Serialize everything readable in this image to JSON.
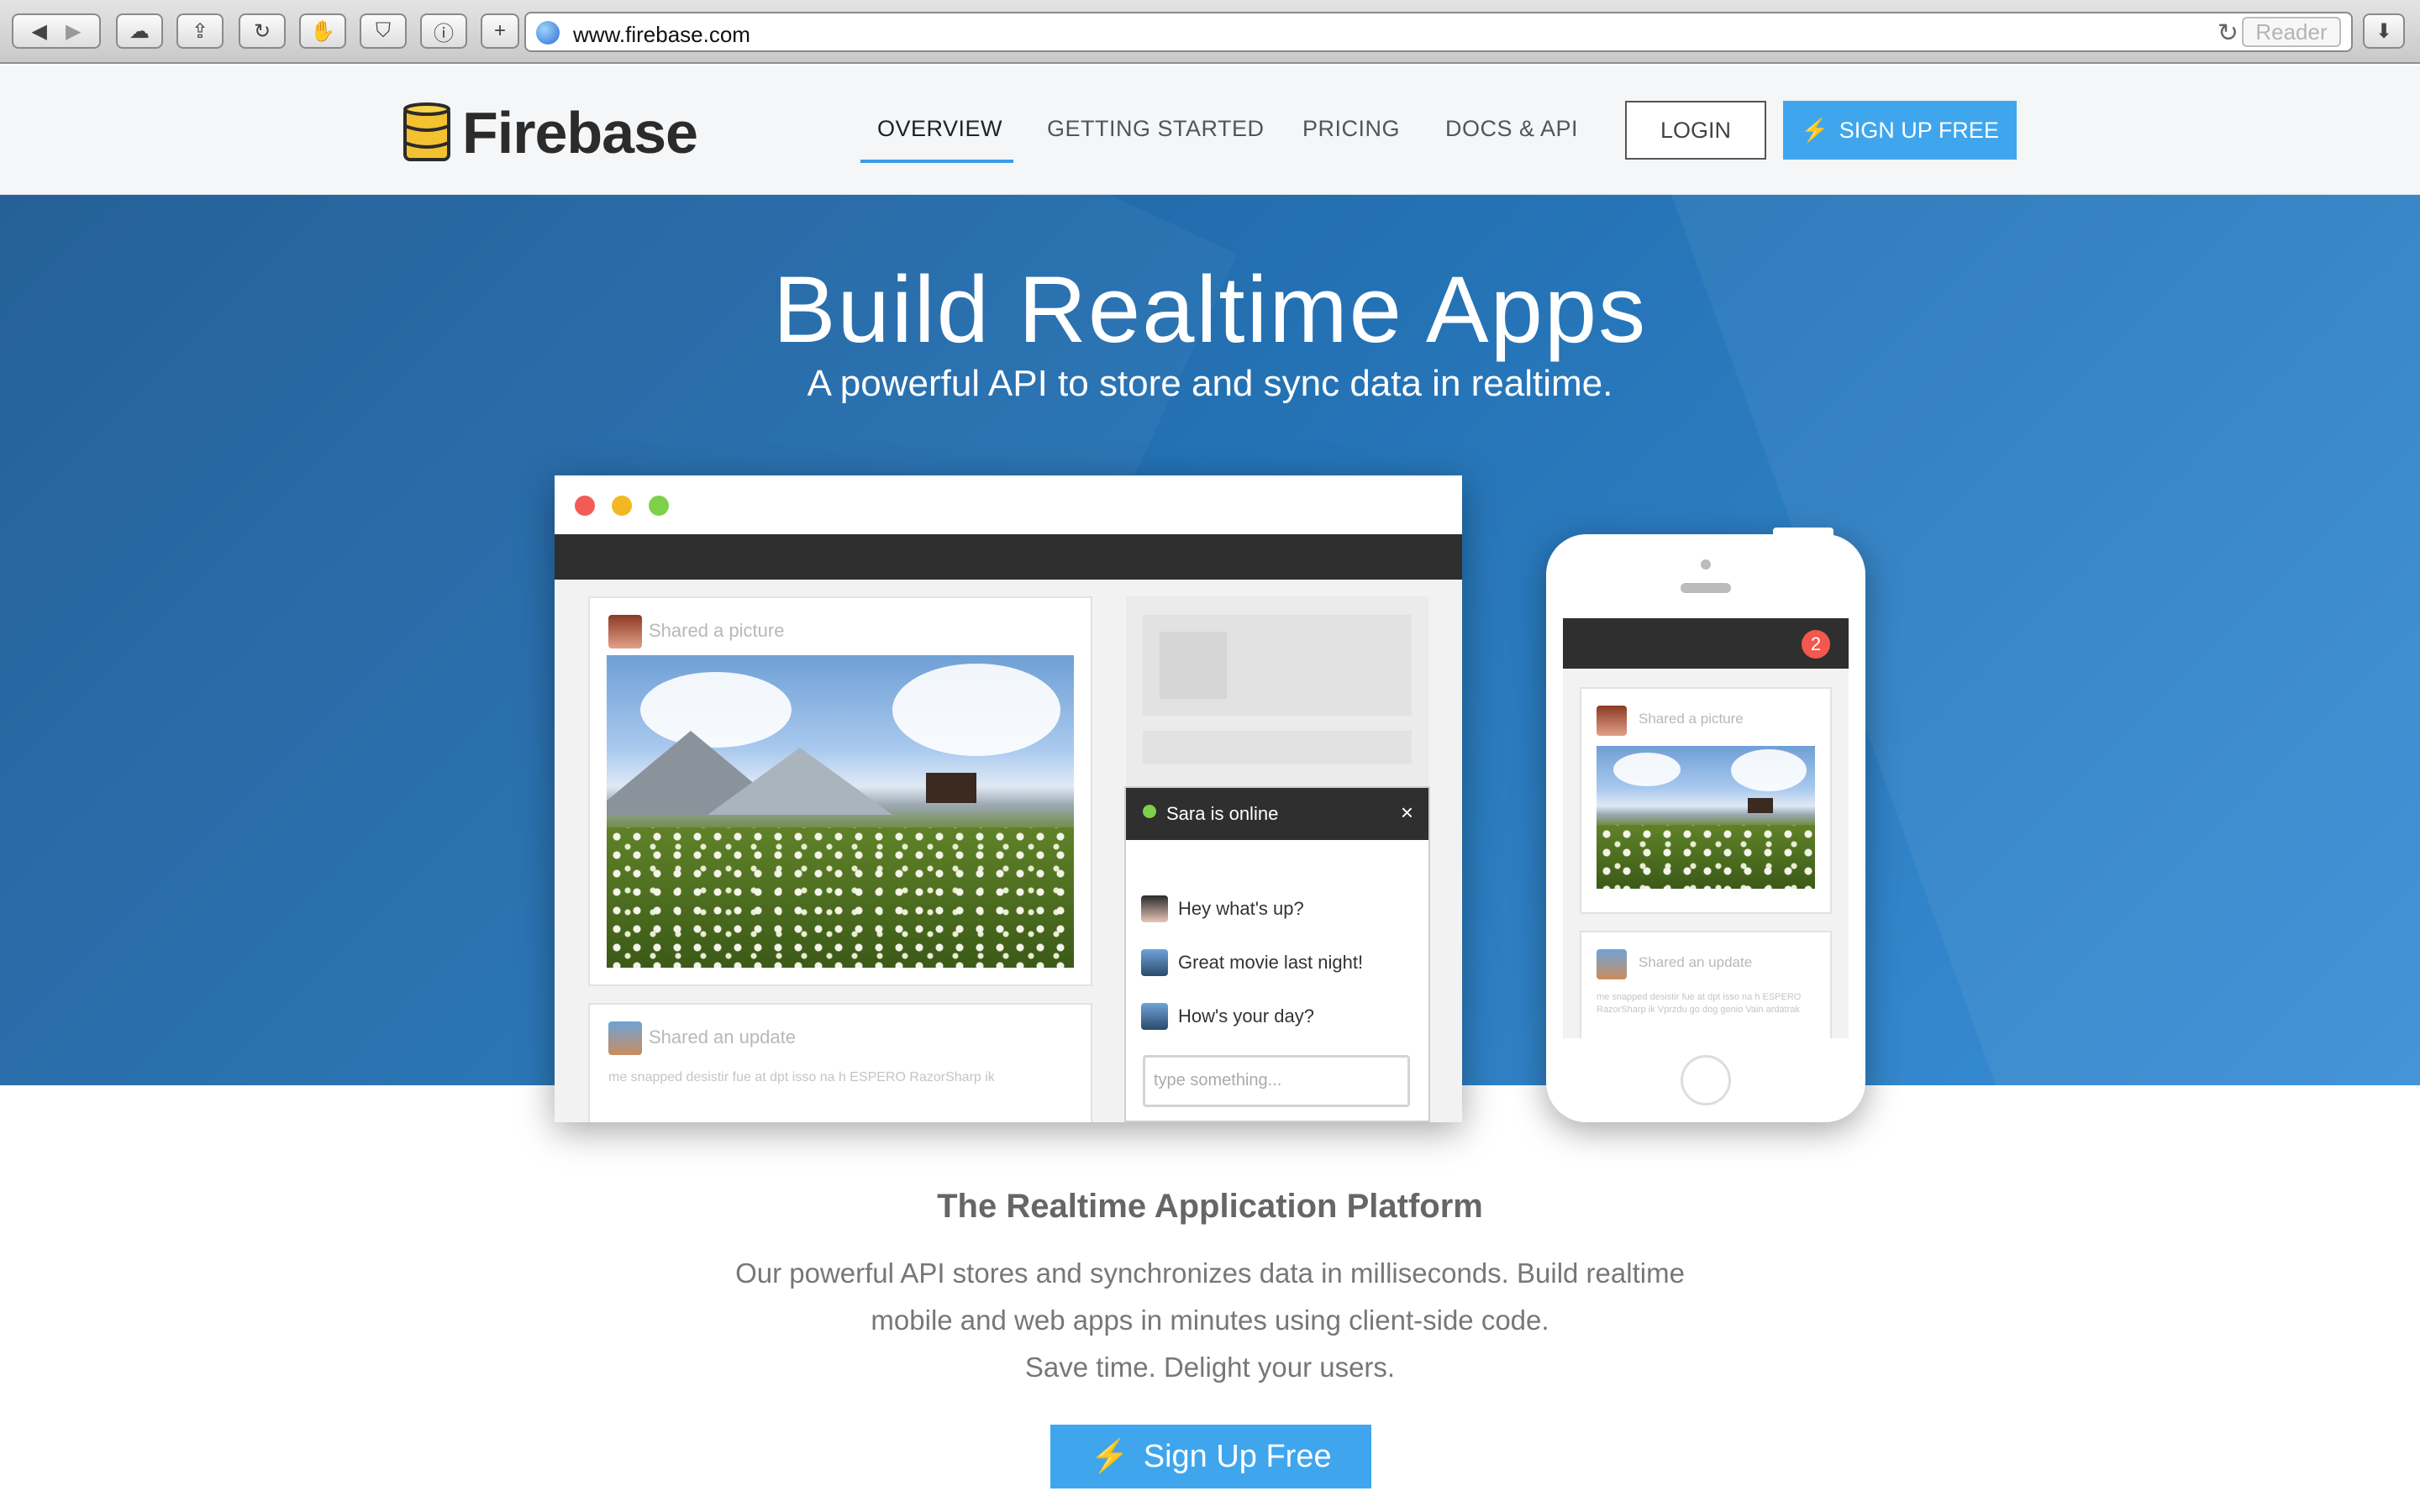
{
  "browser": {
    "url": "www.firebase.com",
    "reader_label": "Reader"
  },
  "nav": {
    "logo_text": "Firebase",
    "items": [
      "OVERVIEW",
      "GETTING STARTED",
      "PRICING",
      "DOCS & API"
    ],
    "active_index": 0,
    "login_label": "LOGIN",
    "signup_label": "SIGN UP FREE"
  },
  "hero": {
    "title": "Build Realtime Apps",
    "subtitle": "A powerful API to store and sync data in realtime."
  },
  "mock_desktop": {
    "card1_title": "Shared a picture",
    "card2_title": "Shared an update",
    "card2_snippet": "me snapped desistir fue at dpt isso na h ESPERO RazorSharp ik",
    "chat": {
      "status": "Sara is online",
      "messages": [
        "Hey what's up?",
        "Great movie last night!",
        "How's your day?"
      ],
      "input_placeholder": "type something..."
    }
  },
  "mock_phone": {
    "badge_count": "2",
    "card1_title": "Shared a picture",
    "card2_title": "Shared an update",
    "card2_snippet": "me snapped desistir fue at dpt isso na h ESPERO RazorSharp ik Vprzdu go dog genio Vain ardatrak"
  },
  "section": {
    "title": "The Realtime Application Platform",
    "line1": "Our powerful API stores and synchronizes data in milliseconds. Build realtime",
    "line2": "mobile and web apps in minutes using client-side code.",
    "line3": "Save time. Delight your users.",
    "cta_label": "Sign Up Free"
  },
  "colors": {
    "accent": "#3fa6ee",
    "hero_blue": "#2472b4",
    "dark_bar": "#2f2f2f",
    "badge_red": "#f2584d"
  }
}
